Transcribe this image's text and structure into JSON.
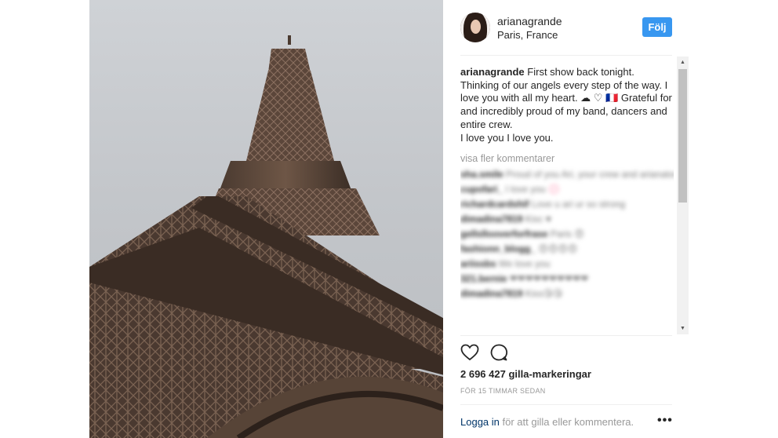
{
  "post": {
    "username": "arianagrande",
    "location": "Paris, France",
    "follow_label": "Följ",
    "caption_user": "arianagrande",
    "caption_text": "First show back tonight. Thinking of our angels every step of the way. I love you with all my heart. ☁ ♡ 🇫🇷 Grateful for and incredibly proud of my band, dancers and entire crew.",
    "caption_last": "I love you I love you.",
    "more_comments": "visa fler kommentarer",
    "comments": [
      {
        "user": "sha.smile",
        "text": "Proud of you Ari, your crew and arianators🖤"
      },
      {
        "user": "cupofari_",
        "text": "I love you 💮"
      },
      {
        "user": "richardcardshif",
        "text": "Love u ari ur so strong"
      },
      {
        "user": "dimadina7819",
        "text": "Kisc ♥"
      },
      {
        "user": "gellsllooverforfrase",
        "text": "Paris 😍"
      },
      {
        "user": "fashionn_blogg_",
        "text": "😍😍😍😍"
      },
      {
        "user": "ariissbs",
        "text": "We love you"
      },
      {
        "user": "321.bernie",
        "text": "❤❤❤❤❤❤❤❤❤❤"
      },
      {
        "user": "dimadina7819",
        "text": "Kiss😘😘"
      }
    ],
    "likes": "2 696 427 gilla-markeringar",
    "timestamp": "FÖR 15 TIMMAR SEDAN",
    "login_link": "Logga in",
    "login_rest": " för att gilla eller kommentera.",
    "more_options": "•••"
  },
  "icons": {
    "like": "heart-outline-icon",
    "comment": "speech-bubble-icon",
    "scroll_up": "triangle-up-icon",
    "scroll_down": "triangle-down-icon"
  },
  "colors": {
    "follow_button": "#3897f0",
    "link": "#003569",
    "muted": "#999999"
  }
}
